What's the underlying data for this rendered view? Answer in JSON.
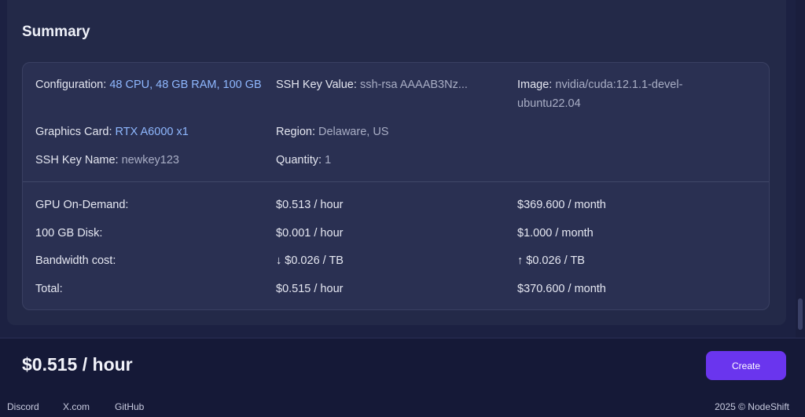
{
  "summary": {
    "title": "Summary",
    "configuration": {
      "label": "Configuration:",
      "value": "48 CPU, 48 GB RAM, 100 GB"
    },
    "ssh_key_value": {
      "label": "SSH Key Value:",
      "value": "ssh-rsa AAAAB3Nz..."
    },
    "image": {
      "label": "Image:",
      "value": "nvidia/cuda:12.1.1-devel-ubuntu22.04"
    },
    "graphics_card": {
      "label": "Graphics Card:",
      "value": "RTX A6000 x1"
    },
    "region": {
      "label": "Region:",
      "value": "Delaware, US"
    },
    "ssh_key_name": {
      "label": "SSH Key Name:",
      "value": "newkey123"
    },
    "quantity": {
      "label": "Quantity:",
      "value": "1"
    }
  },
  "pricing": {
    "rows": [
      {
        "label": "GPU On-Demand:",
        "hourly": "$0.513 / hour",
        "monthly": "$369.600 / month"
      },
      {
        "label": "100 GB Disk:",
        "hourly": "$0.001 / hour",
        "monthly": "$1.000 / month"
      },
      {
        "label": "Bandwidth cost:",
        "hourly": "↓ $0.026 / TB",
        "monthly": "↑ $0.026 / TB"
      },
      {
        "label": "Total:",
        "hourly": "$0.515 / hour",
        "monthly": "$370.600 / month"
      }
    ]
  },
  "bottom_bar": {
    "total_price": "$0.515 / hour",
    "create_label": "Create"
  },
  "footer": {
    "links": [
      "Discord",
      "X.com",
      "GitHub"
    ],
    "copyright": "2025 © NodeShift"
  },
  "colors": {
    "accent_value": "#8fb8ff",
    "create_button": "#6a35ee",
    "card_background": "#232948",
    "details_background": "#2a3052"
  }
}
